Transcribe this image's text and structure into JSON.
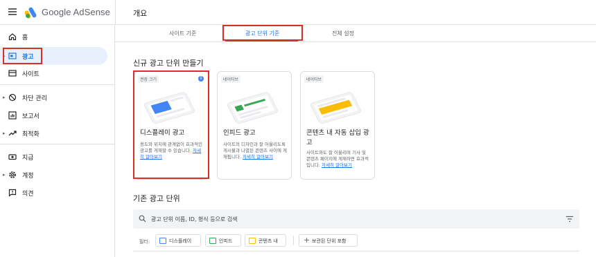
{
  "app": {
    "brand": "Google AdSense",
    "page_title": "개요"
  },
  "sidebar": {
    "items": [
      {
        "label": "홈",
        "icon": "home-icon"
      },
      {
        "label": "광고",
        "icon": "ads-icon",
        "active": true
      },
      {
        "label": "사이트",
        "icon": "sites-icon"
      },
      {
        "label": "차단 관리",
        "icon": "block-icon"
      },
      {
        "label": "보고서",
        "icon": "reports-icon"
      },
      {
        "label": "최적화",
        "icon": "optimization-icon"
      },
      {
        "label": "지급",
        "icon": "payments-icon"
      },
      {
        "label": "계정",
        "icon": "account-icon"
      },
      {
        "label": "의견",
        "icon": "feedback-icon"
      }
    ]
  },
  "tabs": [
    {
      "label": "사이트 기준"
    },
    {
      "label": "광고 단위 기준",
      "active": true
    },
    {
      "label": "전체 설정"
    }
  ],
  "new_units": {
    "title": "신규 광고 단위 만들기",
    "cards": [
      {
        "chip": "권장 크기",
        "title": "디스플레이 광고",
        "desc": "용도와 위치에 관계없이 효과적인 광고를 게재할 수 있습니다.",
        "link": "자세히 알아보기",
        "accent": "#4285f4"
      },
      {
        "chip": "네이티브",
        "title": "인피드 광고",
        "desc": "사이트의 디자인과 잘 어울리도록 게시물과 나열된 콘텐츠 사이에 게재됩니다.",
        "link": "자세히 알아보기",
        "accent": "#34a853"
      },
      {
        "chip": "네이티브",
        "title": "콘텐츠 내 자동 삽입 광고",
        "desc": "사이트와도 잘 어울리며 기사 및 콘텐츠 페이지에 게재하면 효과적입니다.",
        "link": "자세히 알아보기",
        "accent": "#fbbc04"
      }
    ]
  },
  "existing_units": {
    "title": "기존 광고 단위",
    "search_placeholder": "광고 단위 이름, ID, 형식 등으로 검색",
    "filter_label": "필터:",
    "filters": [
      {
        "label": "디스플레이",
        "color": "#4285f4"
      },
      {
        "label": "인피드",
        "color": "#34a853"
      },
      {
        "label": "콘텐츠 내",
        "color": "#fbbc04"
      }
    ],
    "add_filter_label": "보관된 단위 포함"
  }
}
